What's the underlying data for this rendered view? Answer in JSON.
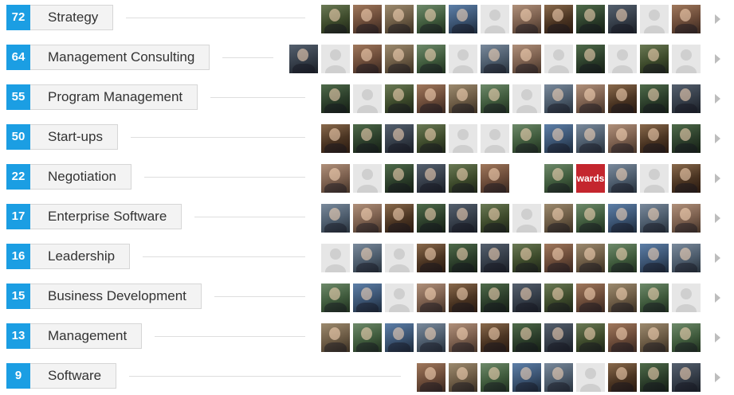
{
  "skills": [
    {
      "count": "72",
      "name": "Strategy",
      "avatars": [
        "p",
        "p",
        "p",
        "p",
        "p",
        "ph",
        "p",
        "p",
        "p",
        "p",
        "ph",
        "p"
      ]
    },
    {
      "count": "64",
      "name": "Management Consulting",
      "avatars": [
        "p",
        "ph",
        "p",
        "p",
        "p",
        "ph",
        "p",
        "p",
        "ph",
        "p",
        "ph",
        "p",
        "ph"
      ]
    },
    {
      "count": "55",
      "name": "Program Management",
      "avatars": [
        "p",
        "ph",
        "p",
        "p",
        "p",
        "p",
        "ph",
        "p",
        "p",
        "p",
        "p",
        "p"
      ]
    },
    {
      "count": "50",
      "name": "Start-ups",
      "avatars": [
        "p",
        "p",
        "p",
        "p",
        "ph",
        "ph",
        "p",
        "p",
        "p",
        "p",
        "p",
        "p"
      ]
    },
    {
      "count": "22",
      "name": "Negotiation",
      "avatars": [
        "p",
        "ph",
        "p",
        "p",
        "p",
        "p",
        "blank",
        "p",
        "text",
        "p",
        "ph",
        "p"
      ]
    },
    {
      "count": "17",
      "name": "Enterprise Software",
      "avatars": [
        "p",
        "p",
        "p",
        "p",
        "p",
        "p",
        "ph",
        "p",
        "p",
        "p",
        "p",
        "p"
      ]
    },
    {
      "count": "16",
      "name": "Leadership",
      "avatars": [
        "ph",
        "p",
        "ph",
        "p",
        "p",
        "p",
        "p",
        "p",
        "p",
        "p",
        "p",
        "p"
      ]
    },
    {
      "count": "15",
      "name": "Business Development",
      "avatars": [
        "p",
        "p",
        "ph",
        "p",
        "p",
        "p",
        "p",
        "p",
        "p",
        "p",
        "p",
        "ph"
      ]
    },
    {
      "count": "13",
      "name": "Management",
      "avatars": [
        "p",
        "p",
        "p",
        "p",
        "p",
        "p",
        "p",
        "p",
        "p",
        "p",
        "p",
        "p"
      ]
    },
    {
      "count": "9",
      "name": "Software",
      "avatars": [
        "p",
        "p",
        "p",
        "p",
        "p",
        "ph",
        "p",
        "p",
        "p"
      ]
    }
  ],
  "badge_text": "wards",
  "colors": {
    "count_badge": "#1b9ee3",
    "label_bg": "#f3f3f3",
    "placeholder": "#e6e6e6"
  }
}
